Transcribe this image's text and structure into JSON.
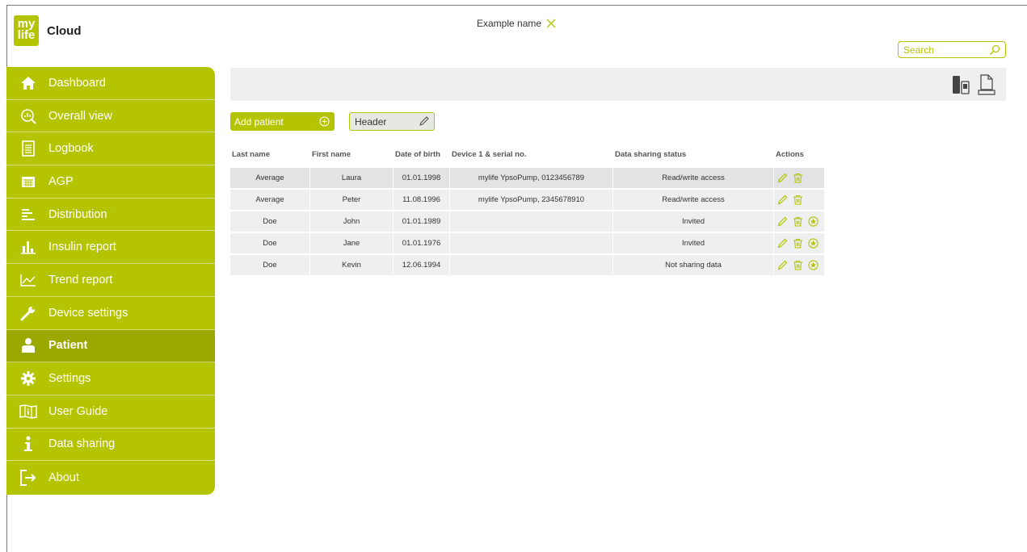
{
  "brand": {
    "logo_top": "my",
    "logo_bottom": "life",
    "product": "Cloud",
    "accent": "#b5c400"
  },
  "header": {
    "user_name": "Example name",
    "close_icon": "close-icon"
  },
  "search": {
    "placeholder": "Search",
    "icon": "search-icon"
  },
  "sidebar": {
    "items": [
      {
        "label": "Dashboard",
        "icon": "home-icon"
      },
      {
        "label": "Overall view",
        "icon": "magnifier-chart-icon"
      },
      {
        "label": "Logbook",
        "icon": "logbook-icon"
      },
      {
        "label": "AGP",
        "icon": "calendar-icon"
      },
      {
        "label": "Distribution",
        "icon": "distribution-icon"
      },
      {
        "label": "Insulin report",
        "icon": "bar-chart-icon"
      },
      {
        "label": "Trend report",
        "icon": "trend-icon"
      },
      {
        "label": "Device settings",
        "icon": "wrench-icon"
      },
      {
        "label": "Patient",
        "icon": "person-icon",
        "active": true
      },
      {
        "label": "Settings",
        "icon": "gear-icon"
      },
      {
        "label": "User Guide",
        "icon": "book-icon"
      },
      {
        "label": "Data sharing",
        "icon": "info-icon"
      },
      {
        "label": "About",
        "icon": "logout-icon"
      }
    ]
  },
  "toolbar": {
    "device_icon": "device-icon",
    "document_icon": "document-icon"
  },
  "actions": {
    "add_patient": "Add patient",
    "header_field": "Header"
  },
  "table": {
    "columns": [
      "Last name",
      "First name",
      "Date of birth",
      "Device 1 & serial no.",
      "Data sharing status",
      "Actions"
    ],
    "rows": [
      {
        "last": "Average",
        "first": "Laura",
        "dob": "01.01.1998",
        "device": "mylife YpsoPump, 0123456789",
        "status": "Read/write access",
        "star": false
      },
      {
        "last": "Average",
        "first": "Peter",
        "dob": "11.08.1996",
        "device": "mylife YpsoPump, 2345678910",
        "status": "Read/write access",
        "star": false
      },
      {
        "last": "Doe",
        "first": "John",
        "dob": "01.01.1989",
        "device": "",
        "status": "Invited",
        "star": true
      },
      {
        "last": "Doe",
        "first": "Jane",
        "dob": "01.01.1976",
        "device": "",
        "status": "Invited",
        "star": true
      },
      {
        "last": "Doe",
        "first": "Kevin",
        "dob": "12.06.1994",
        "device": "",
        "status": "Not sharing data",
        "star": true
      }
    ]
  }
}
